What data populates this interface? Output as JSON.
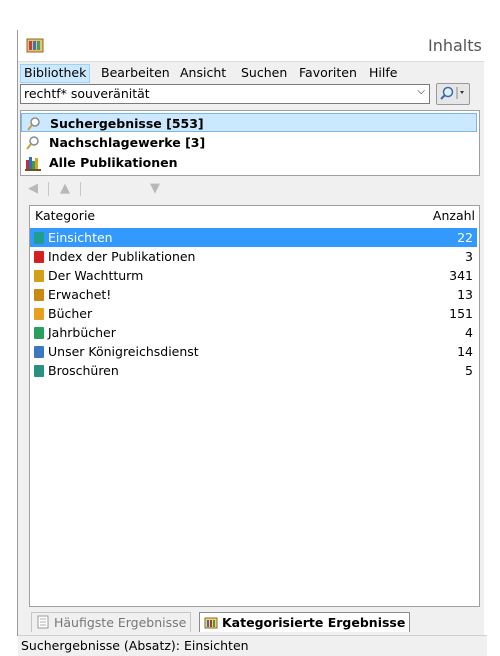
{
  "window": {
    "title": "Inhalts"
  },
  "menu": {
    "items": [
      {
        "label": "Bibliothek"
      },
      {
        "label": "Bearbeiten"
      },
      {
        "label": "Ansicht"
      },
      {
        "label": "Suchen"
      },
      {
        "label": "Favoriten"
      },
      {
        "label": "Hilfe"
      }
    ],
    "active": "Bibliothek"
  },
  "search": {
    "value": "rechtf* souveränität"
  },
  "nav": {
    "items": [
      {
        "label": "Suchergebnisse [553]",
        "icon": "magnifier-icon",
        "selected": true
      },
      {
        "label": "Nachschlagewerke [3]",
        "icon": "magnifier-icon",
        "selected": false
      },
      {
        "label": "Alle Publikationen",
        "icon": "bookshelf-icon",
        "selected": false
      }
    ]
  },
  "grid": {
    "columns": {
      "category": "Kategorie",
      "count": "Anzahl"
    },
    "rows": [
      {
        "name": "Einsichten",
        "count": "22",
        "color": "#1f9e8f",
        "selected": true
      },
      {
        "name": "Index der Publikationen",
        "count": "3",
        "color": "#d62020",
        "selected": false
      },
      {
        "name": "Der Wachtturm",
        "count": "341",
        "color": "#d4a017",
        "selected": false
      },
      {
        "name": "Erwachet!",
        "count": "13",
        "color": "#c98a10",
        "selected": false
      },
      {
        "name": "Bücher",
        "count": "151",
        "color": "#e8a020",
        "selected": false
      },
      {
        "name": "Jahrbücher",
        "count": "4",
        "color": "#2aa060",
        "selected": false
      },
      {
        "name": "Unser Königreichsdienst",
        "count": "14",
        "color": "#3a78c0",
        "selected": false
      },
      {
        "name": "Broschüren",
        "count": "5",
        "color": "#2a9080",
        "selected": false
      }
    ]
  },
  "tabs": [
    {
      "label": "Häufigste Ergebnisse",
      "active": false
    },
    {
      "label": "Kategorisierte Ergebnisse",
      "active": true
    }
  ],
  "status": "Suchergebnisse (Absatz): Einsichten"
}
